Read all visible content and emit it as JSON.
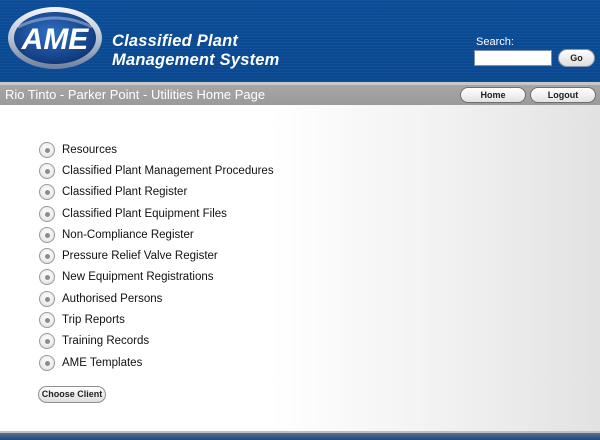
{
  "header": {
    "logo_text": "AME",
    "title_line1": "Classified Plant",
    "title_line2": "Management System",
    "search_label": "Search:",
    "search_value": "",
    "go_label": "Go"
  },
  "titlebar": {
    "page_title": "Rio Tinto - Parker Point - Utilities Home Page",
    "home_label": "Home",
    "logout_label": "Logout"
  },
  "menu": {
    "items": [
      {
        "label": "Resources"
      },
      {
        "label": "Classified Plant Management Procedures"
      },
      {
        "label": "Classified Plant Register"
      },
      {
        "label": "Classified Plant Equipment Files"
      },
      {
        "label": "Non-Compliance Register"
      },
      {
        "label": "Pressure Relief Valve Register"
      },
      {
        "label": "New Equipment Registrations"
      },
      {
        "label": "Authorised Persons"
      },
      {
        "label": "Trip Reports"
      },
      {
        "label": "Training Records"
      },
      {
        "label": "AME Templates"
      }
    ]
  },
  "actions": {
    "choose_client_label": "Choose Client"
  },
  "colors": {
    "header_blue": "#0b4d98",
    "titlebar_gray": "#a0a0a0"
  }
}
